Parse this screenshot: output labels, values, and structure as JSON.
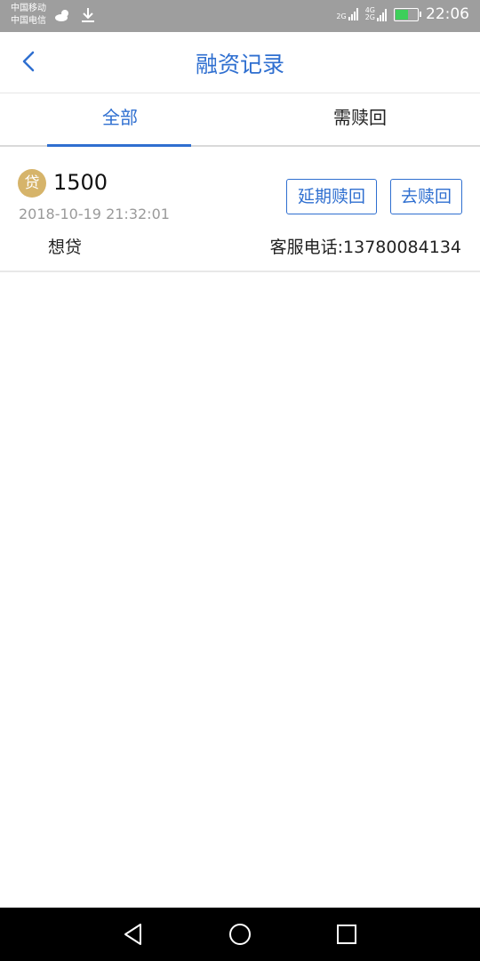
{
  "status_bar": {
    "carrier1": "中国移动",
    "carrier2": "中国电信",
    "net1": "2G",
    "net2_top": "4G",
    "net2_bottom": "2G",
    "time": "22:06"
  },
  "header": {
    "title": "融资记录"
  },
  "tabs": [
    {
      "label": "全部",
      "active": true
    },
    {
      "label": "需赎回",
      "active": false
    }
  ],
  "record": {
    "badge": "贷",
    "amount": "1500",
    "date": "2018-10-19 21:32:01",
    "product": "想贷",
    "phone": "客服电话:13780084134",
    "delay_button": "延期赎回",
    "redeem_button": "去赎回"
  },
  "colors": {
    "accent": "#2f6fd0",
    "badge": "#d6b46a",
    "status_bar": "#9e9e9e"
  }
}
